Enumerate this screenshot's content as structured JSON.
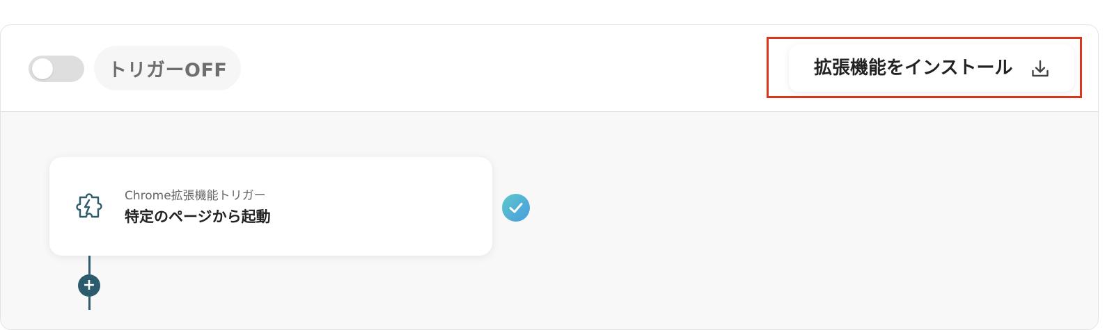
{
  "header": {
    "trigger_toggle": {
      "state": "off"
    },
    "trigger_status_label": "トリガーOFF",
    "install_button": {
      "label": "拡張機能をインストール",
      "icon": "download-icon"
    }
  },
  "workflow": {
    "trigger_node": {
      "type_label": "Chrome拡張機能トリガー",
      "title": "特定のページから起動",
      "icon": "puzzle-piece-icon",
      "status_icon": "check-icon"
    },
    "add_step": {
      "icon": "plus-icon"
    }
  },
  "colors": {
    "highlight": "#d9361c",
    "accent": "#2c5b6e",
    "check_gradient_start": "#5cc9c9",
    "check_gradient_end": "#4a9be0"
  }
}
